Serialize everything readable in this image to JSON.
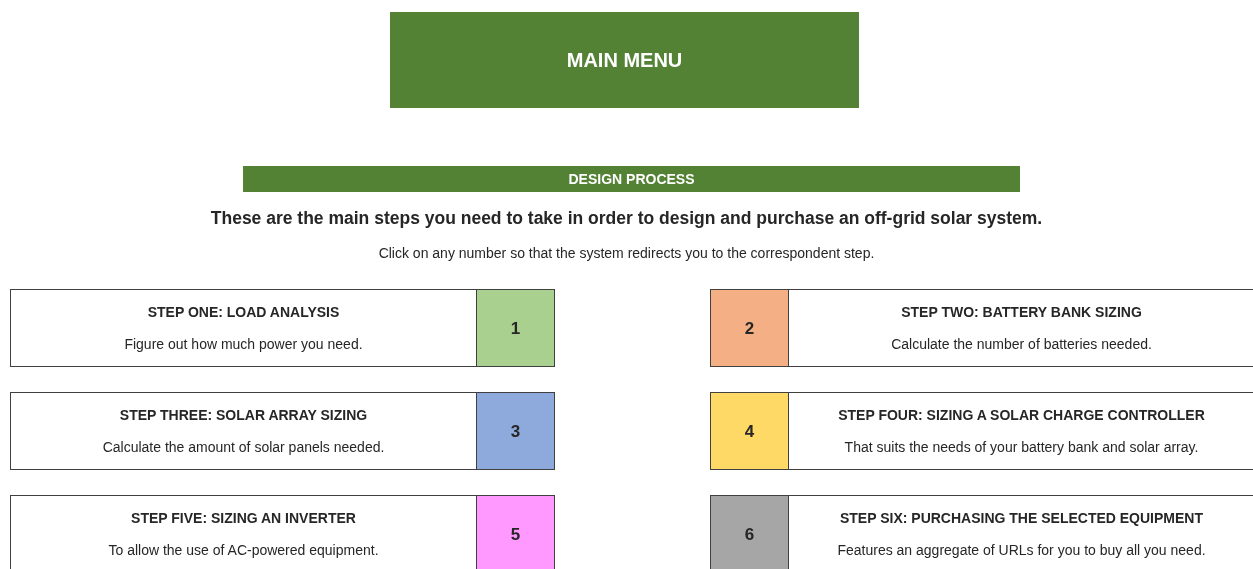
{
  "main_menu": {
    "label": "MAIN MENU"
  },
  "section_bar": {
    "label": "DESIGN PROCESS"
  },
  "heading": "These are the main steps you need to take in order to design and purchase an off-grid solar system.",
  "instruction": "Click on any number so that the system redirects you to the correspondent step.",
  "steps": [
    {
      "number": "1",
      "title": "STEP ONE: LOAD ANALYSIS",
      "description": "Figure out how much power you need.",
      "color": "#a9d08e"
    },
    {
      "number": "2",
      "title": "STEP TWO: BATTERY BANK SIZING",
      "description": "Calculate the number of batteries needed.",
      "color": "#f4b084"
    },
    {
      "number": "3",
      "title": "STEP THREE: SOLAR ARRAY SIZING",
      "description": "Calculate the amount of solar panels needed.",
      "color": "#8ea9db"
    },
    {
      "number": "4",
      "title": "STEP FOUR: SIZING A SOLAR CHARGE CONTROLLER",
      "description": "That suits the needs of your battery bank and solar array.",
      "color": "#ffd966"
    },
    {
      "number": "5",
      "title": "STEP FIVE: SIZING AN INVERTER",
      "description": "To allow the use of AC-powered equipment.",
      "color": "#ff99ff"
    },
    {
      "number": "6",
      "title": "STEP SIX: PURCHASING THE SELECTED EQUIPMENT",
      "description": "Features an aggregate of URLs for you to buy all you need.",
      "color": "#a6a6a6"
    }
  ]
}
